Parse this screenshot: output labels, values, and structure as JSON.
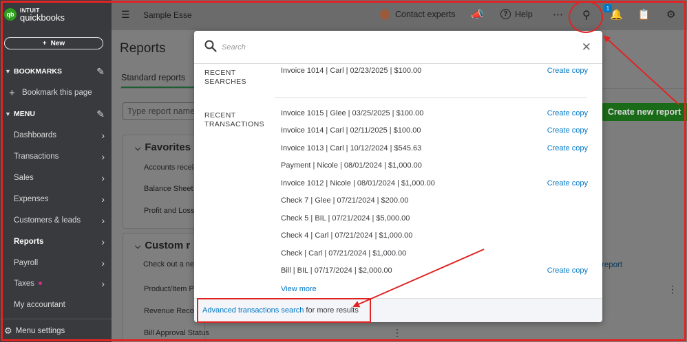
{
  "app": {
    "logo_brand": "INTUIT",
    "logo_product": "quickbooks",
    "logo_mark": "qb",
    "company_name": "Sample Esse"
  },
  "sidebar": {
    "new_label": "New",
    "bookmarks_label": "BOOKMARKS",
    "bookmark_page_label": "Bookmark this page",
    "menu_label": "MENU",
    "items": [
      {
        "label": "Dashboards"
      },
      {
        "label": "Transactions"
      },
      {
        "label": "Sales"
      },
      {
        "label": "Expenses"
      },
      {
        "label": "Customers & leads"
      },
      {
        "label": "Reports"
      },
      {
        "label": "Payroll"
      },
      {
        "label": "Taxes"
      },
      {
        "label": "My accountant"
      }
    ],
    "menu_settings_label": "Menu settings"
  },
  "topbar": {
    "contact_label": "Contact experts",
    "help_label": "Help",
    "notification_count": "1"
  },
  "main": {
    "page_title": "Reports",
    "standard_tab": "Standard reports",
    "search_placeholder": "Type report name",
    "create_report_label": "Create new report",
    "favorites_title": "Favorites",
    "favorites_rows": [
      "Accounts recei",
      "Balance Sheet",
      "Profit and Loss"
    ],
    "custom_title": "Custom r",
    "custom_intro": "Check out a ne",
    "custom_rows": [
      "Product/Item P",
      "Revenue Reco",
      "Bill Approval Status"
    ],
    "custom_link": "report"
  },
  "modal": {
    "search_placeholder": "Search",
    "recent_searches_label": "RECENT SEARCHES",
    "recent_transactions_label": "RECENT TRANSACTIONS",
    "recent_searches": [
      {
        "text": "Invoice 1014 | Carl | 02/23/2025 | $100.00",
        "action": "Create copy"
      }
    ],
    "recent_transactions": [
      {
        "text": "Invoice 1015 | Glee | 03/25/2025 | $100.00",
        "action": "Create copy"
      },
      {
        "text": "Invoice 1014 | Carl | 02/11/2025 | $100.00",
        "action": "Create copy"
      },
      {
        "text": "Invoice 1013 | Carl | 10/12/2024 | $545.63",
        "action": "Create copy"
      },
      {
        "text": "Payment  | Nicole | 08/01/2024 | $1,000.00",
        "action": ""
      },
      {
        "text": "Invoice 1012 | Nicole | 08/01/2024 | $1,000.00",
        "action": "Create copy"
      },
      {
        "text": "Check 7 | Glee | 07/21/2024 | $200.00",
        "action": ""
      },
      {
        "text": "Check 5 | BIL | 07/21/2024 | $5,000.00",
        "action": ""
      },
      {
        "text": "Check 4 | Carl | 07/21/2024 | $1,000.00",
        "action": ""
      },
      {
        "text": "Check  | Carl | 07/21/2024 | $1,000.00",
        "action": ""
      },
      {
        "text": "Bill  | BIL | 07/17/2024 | $2,000.00",
        "action": "Create copy"
      }
    ],
    "view_more_label": "View more",
    "advanced_link": "Advanced transactions search",
    "advanced_suffix": " for more results"
  },
  "colors": {
    "brand_green": "#2ca01c",
    "link_blue": "#0077c5",
    "annotation_red": "#e02424"
  }
}
